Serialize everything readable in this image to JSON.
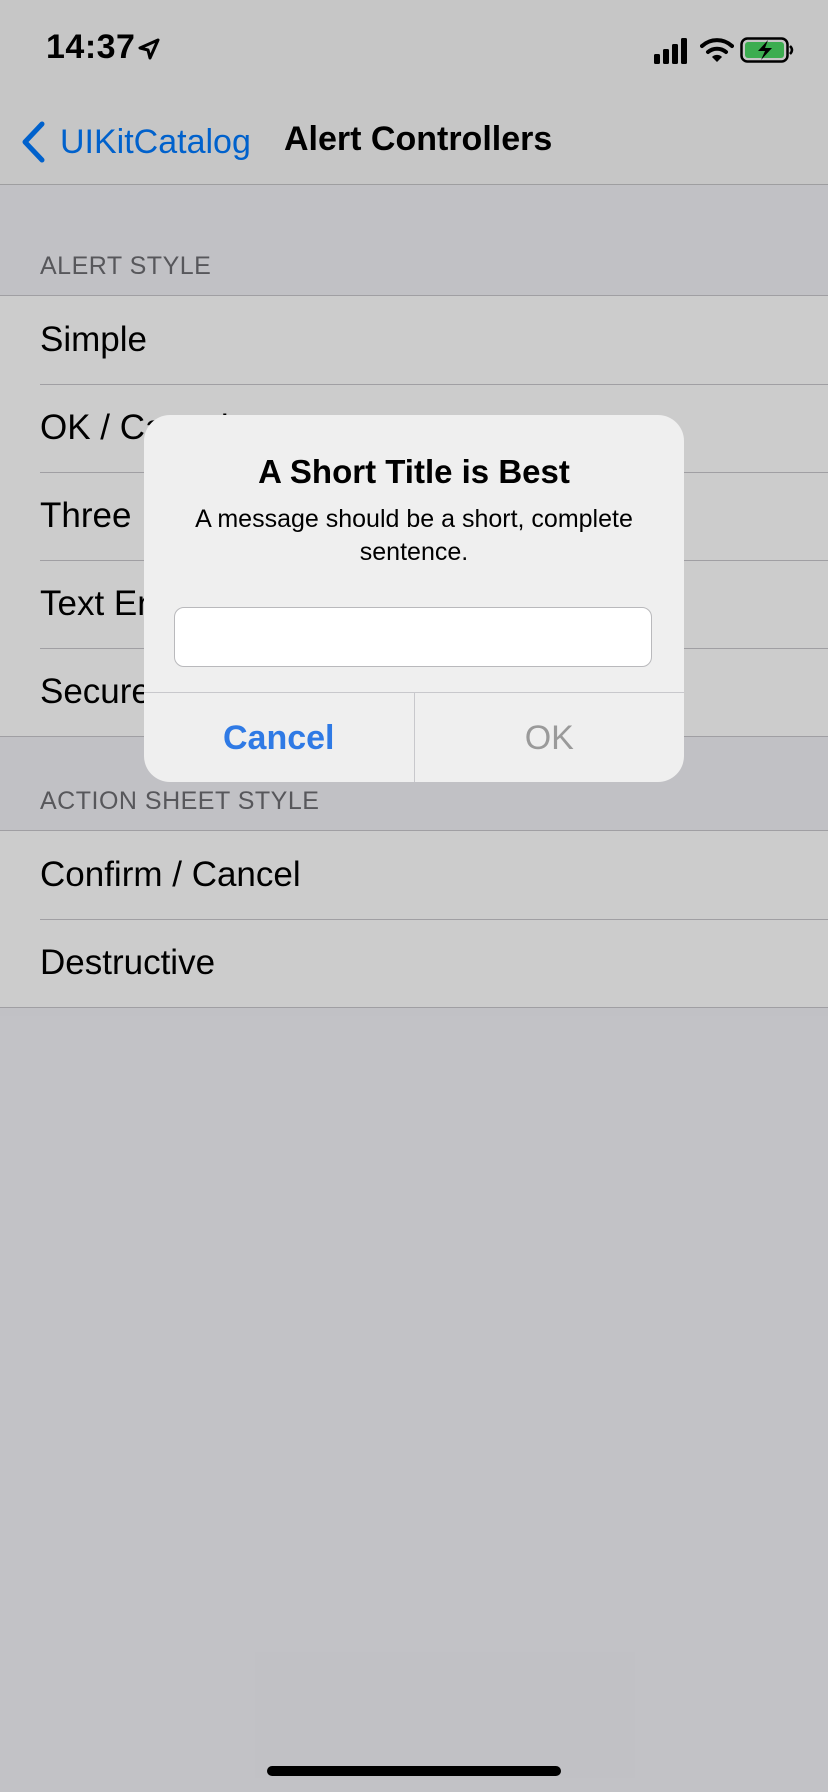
{
  "status_bar": {
    "time": "14:37",
    "icons": [
      "location-arrow-icon",
      "cellular-signal-icon",
      "wifi-icon",
      "battery-charging-icon"
    ]
  },
  "nav": {
    "back_label": "UIKitCatalog",
    "title": "Alert Controllers"
  },
  "sections": {
    "alert_style": {
      "header": "ALERT STYLE",
      "rows": [
        "Simple",
        "OK / Cancel",
        "Three Buttons",
        "Text Entry",
        "Secure Text Entry"
      ]
    },
    "action_sheet_style": {
      "header": "ACTION SHEET STYLE",
      "rows": [
        "Confirm / Cancel",
        "Destructive"
      ]
    }
  },
  "alert": {
    "title": "A Short Title is Best",
    "message": "A message should be a short, complete sentence.",
    "input_value": "",
    "cancel_label": "Cancel",
    "ok_label": "OK"
  },
  "colors": {
    "accent": "#007aff",
    "cancel": "#2f7ae5",
    "ok_disabled": "#9a9a9a",
    "battery_fill": "#4cd964"
  }
}
